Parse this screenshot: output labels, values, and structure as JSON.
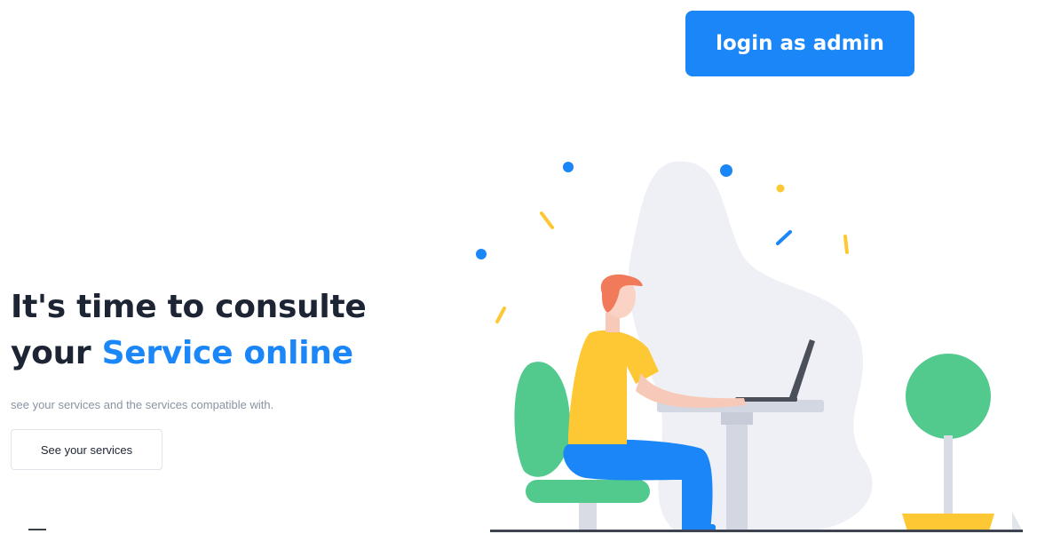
{
  "header": {
    "admin_button_label": "login as admin"
  },
  "hero": {
    "title_line1": "It's time to consulte",
    "title_line2_prefix": "your ",
    "title_line2_accent": "Service online",
    "subtitle": "see your services and the services compatible with.",
    "cta_label": "See your services"
  },
  "colors": {
    "accent": "#1a86f7",
    "heading": "#1d2433",
    "muted": "#8a93a3",
    "green": "#52c98d",
    "yellow": "#fdc834",
    "blue_pants": "#1a86f7"
  },
  "illustration": {
    "name": "person-working-on-laptop-illustration"
  }
}
